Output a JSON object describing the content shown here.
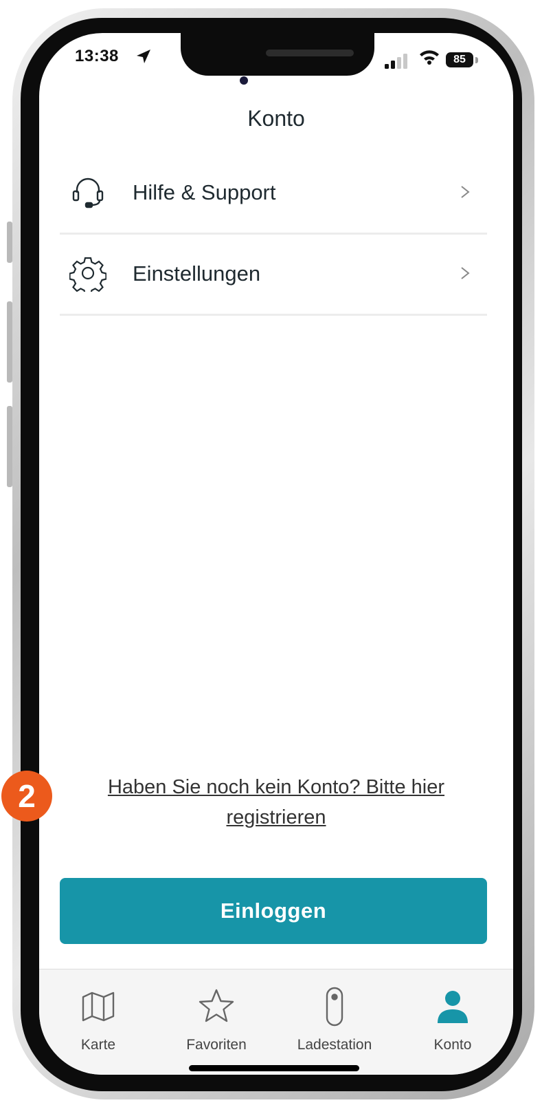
{
  "status_bar": {
    "time": "13:38",
    "battery": "85"
  },
  "header": {
    "title": "Konto"
  },
  "menu": [
    {
      "label": "Hilfe & Support",
      "icon": "headset-icon"
    },
    {
      "label": "Einstellungen",
      "icon": "gear-icon"
    }
  ],
  "register": {
    "text": "Haben Sie noch kein Konto? Bitte hier registrieren"
  },
  "login": {
    "label": "Einloggen"
  },
  "tabs": [
    {
      "label": "Karte",
      "icon": "map-icon"
    },
    {
      "label": "Favoriten",
      "icon": "star-icon"
    },
    {
      "label": "Ladestation",
      "icon": "charger-icon"
    },
    {
      "label": "Konto",
      "icon": "person-icon"
    }
  ],
  "annotation": {
    "step": "2"
  },
  "colors": {
    "accent": "#1795a8",
    "badge": "#ec5a1c",
    "text": "#1f2a30"
  }
}
